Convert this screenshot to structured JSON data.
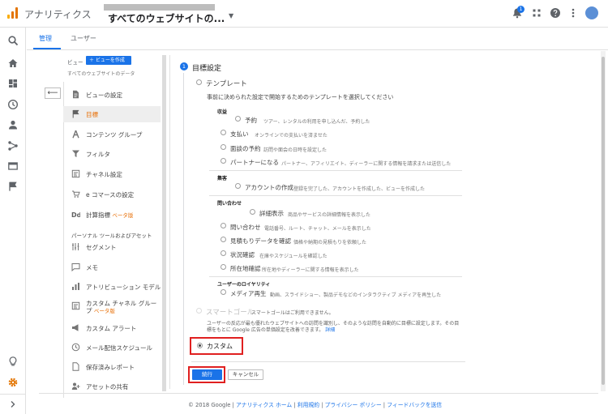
{
  "header": {
    "app_name": "アナリティクス",
    "property_name": "すべてのウェブサイトの...",
    "notification_count": "1",
    "colors": {
      "logo": [
        "#f9ab00",
        "#e37400",
        "#e37400"
      ],
      "accent": "#1a73e8"
    }
  },
  "tabs": [
    {
      "label": "管理",
      "active": true
    },
    {
      "label": "ユーザー",
      "active": false
    }
  ],
  "view_column": {
    "heading": "ビュー",
    "create_button": "＋ ビューを作成",
    "view_name": "すべてのウェブサイトのデータ",
    "back_icon": "arrow-left-icon",
    "items": [
      {
        "label": "ビューの設定",
        "icon": "document-icon"
      },
      {
        "label": "目標",
        "icon": "flag-icon",
        "active": true
      },
      {
        "label": "コンテンツ グループ",
        "icon": "person-walk-icon"
      },
      {
        "label": "フィルタ",
        "icon": "filter-icon"
      },
      {
        "label": "チャネル設定",
        "icon": "channel-icon"
      },
      {
        "label": "e コマースの設定",
        "icon": "cart-icon"
      },
      {
        "label": "計算指標",
        "icon": "calc-icon",
        "tag": "ベータ版"
      },
      {
        "label": "セグメント",
        "icon": "segment-icon"
      },
      {
        "label": "メモ",
        "icon": "note-icon"
      },
      {
        "label": "アトリビューション モデル",
        "icon": "chart-icon"
      },
      {
        "label": "カスタム チャネル グループ",
        "icon": "channel-icon",
        "tag": "ベータ版"
      },
      {
        "label": "カスタム アラート",
        "icon": "megaphone-icon"
      },
      {
        "label": "メール配信スケジュール",
        "icon": "clock-icon"
      },
      {
        "label": "保存済みレポート",
        "icon": "document-icon"
      },
      {
        "label": "アセットの共有",
        "icon": "share-icon"
      }
    ],
    "section_label": "パーソナル ツールおよびアセット"
  },
  "goal_setup": {
    "step_number": "1",
    "title": "目標設定",
    "template": {
      "label": "テンプレート",
      "description": "事前に決められた設定で開始するためのテンプレートを選択してください",
      "categories": [
        {
          "name": "収益",
          "options": [
            {
              "label": "予約",
              "desc": "ツアー、レンタルの利用を申し込んだ、予約した"
            },
            {
              "label": "支払い",
              "desc": "オンラインでの支払いを済ませた"
            },
            {
              "label": "面談の予約",
              "desc": "訪問や面会の日時を設定した"
            },
            {
              "label": "パートナーになる",
              "desc": "パートナー、アフィリエイト、ディーラーに関する情報を請求または送信した"
            }
          ]
        },
        {
          "name": "集客",
          "options": [
            {
              "label": "アカウントの作成",
              "desc": "登録を完了した、アカウントを作成した、ビューを作成した"
            }
          ]
        },
        {
          "name": "問い合わせ",
          "options": [
            {
              "label": "詳細表示",
              "desc": "商品やサービスの詳細情報を表示した"
            },
            {
              "label": "問い合わせ",
              "desc": "電話番号、ルート、チャット、メールを表示した"
            },
            {
              "label": "見積もりデータを確認",
              "desc": "価格や納期の見積もりを依頼した"
            },
            {
              "label": "状況確認",
              "desc": "在庫やスケジュールを確認した"
            },
            {
              "label": "所在地確認",
              "desc": "所在地やディーラーに関する情報を表示した"
            }
          ]
        },
        {
          "name": "ユーザーのロイヤリティ",
          "options": [
            {
              "label": "メディア再生",
              "desc": "動画、スライドショー、製品デモなどのインタラクティブ メディアを再生した"
            }
          ]
        }
      ]
    },
    "smart_goal": {
      "label": "スマートゴール",
      "unavailable": "スマートゴールはご利用できません。",
      "description_1": "ユーザーの反応が最も優れたウェブサイトへの訪問を識別し、そのような訪問を自動的に目標に設定します。その目",
      "description_2": "標をもとに Google 広告の単価設定を改善できます。",
      "learn_more": "詳細"
    },
    "custom": {
      "label": "カスタム",
      "selected": true
    },
    "continue_button": "続行",
    "cancel_button": "キャンセル"
  },
  "footer": {
    "copyright": "© 2018 Google",
    "links": [
      "アナリティクス ホーム",
      "利用規約",
      "プライバシー ポリシー",
      "フィードバックを送信"
    ]
  }
}
